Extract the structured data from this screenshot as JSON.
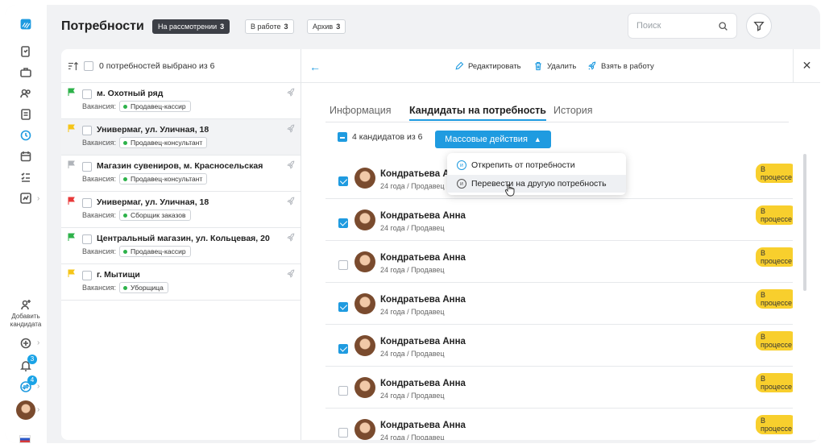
{
  "header": {
    "title": "Потребности",
    "tabs": [
      {
        "label": "На рассмотрении",
        "count": "3"
      },
      {
        "label": "В работе",
        "count": "3"
      },
      {
        "label": "Архив",
        "count": "3"
      }
    ],
    "search_placeholder": "Поиск"
  },
  "sidebar": {
    "add_candidate": "Добавить кандидата",
    "notif_count": "3",
    "transfer_count": "4"
  },
  "list": {
    "selected_text": "0 потребностей выбрано из 6",
    "vacancy_label": "Вакансия:",
    "items": [
      {
        "title": "м. Охотный ряд",
        "vacancy": "Продавец-кассир",
        "flag_color": "#2db24a"
      },
      {
        "title": "Универмаг, ул. Уличная, 18",
        "vacancy": "Продавец-консультант",
        "flag_color": "#f5c518"
      },
      {
        "title": "Магазин сувениров, м. Красносельская",
        "vacancy": "Продавец-консультант",
        "flag_color": "#b0b4ba"
      },
      {
        "title": "Универмаг, ул. Уличная, 18",
        "vacancy": "Сборщик заказов",
        "flag_color": "#e8393a"
      },
      {
        "title": "Центральный магазин, ул. Кольцевая, 20",
        "vacancy": "Продавец-кассир",
        "flag_color": "#2db24a"
      },
      {
        "title": "г. Мытищи",
        "vacancy": "Уборщица",
        "flag_color": "#f5c518"
      }
    ]
  },
  "toolbar": {
    "edit": "Редактировать",
    "delete": "Удалить",
    "take": "Взять в работу"
  },
  "detail": {
    "tabs": [
      "Информация",
      "Кандидаты на потребность",
      "История"
    ],
    "selected_text": "4 кандидатов из 6",
    "mass_actions": "Массовые действия",
    "dropdown": [
      "Открепить от потребности",
      "Перевести на другую потребность"
    ],
    "candidates": [
      {
        "name": "Кондратьева Анна",
        "meta": "24 года / Продавец",
        "status": "В процессе",
        "checked": true
      },
      {
        "name": "Кондратьева Анна",
        "meta": "24 года / Продавец",
        "status": "В процессе",
        "checked": true
      },
      {
        "name": "Кондратьева Анна",
        "meta": "24 года / Продавец",
        "status": "В процессе",
        "checked": false
      },
      {
        "name": "Кондратьева Анна",
        "meta": "24 года / Продавец",
        "status": "В процессе",
        "checked": true
      },
      {
        "name": "Кондратьева Анна",
        "meta": "24 года / Продавец",
        "status": "В процессе",
        "checked": true
      },
      {
        "name": "Кондратьева Анна",
        "meta": "24 года / Продавец",
        "status": "В процессе",
        "checked": false
      },
      {
        "name": "Кондратьева Анна",
        "meta": "24 года / Продавец",
        "status": "В процессе",
        "checked": false
      }
    ]
  },
  "colors": {
    "accent": "#1f9be0",
    "status": "#f8cf2d"
  }
}
